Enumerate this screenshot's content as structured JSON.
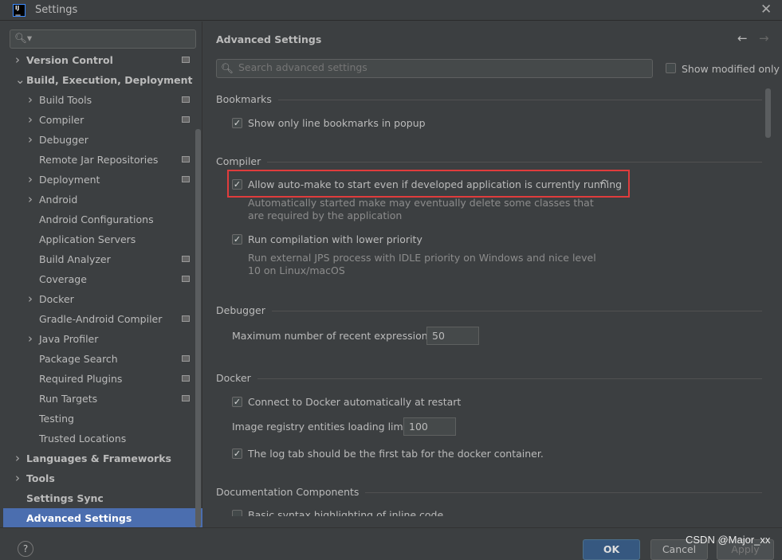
{
  "window": {
    "title": "Settings",
    "logo": "IJ"
  },
  "sidebar": {
    "search_placeholder": "",
    "items": [
      {
        "label": "Version Control",
        "bold": true,
        "expand": "collapsed",
        "level": 0,
        "project_icon": true
      },
      {
        "label": "Build, Execution, Deployment",
        "bold": true,
        "expand": "expanded",
        "level": 0,
        "project_icon": false
      },
      {
        "label": "Build Tools",
        "expand": "collapsed",
        "level": 1,
        "project_icon": true
      },
      {
        "label": "Compiler",
        "expand": "collapsed",
        "level": 1,
        "project_icon": true
      },
      {
        "label": "Debugger",
        "expand": "collapsed",
        "level": 1,
        "project_icon": false
      },
      {
        "label": "Remote Jar Repositories",
        "level": 1,
        "project_icon": true
      },
      {
        "label": "Deployment",
        "expand": "collapsed",
        "level": 1,
        "project_icon": true
      },
      {
        "label": "Android",
        "expand": "collapsed",
        "level": 1,
        "project_icon": false
      },
      {
        "label": "Android Configurations",
        "level": 1,
        "project_icon": false
      },
      {
        "label": "Application Servers",
        "level": 1,
        "project_icon": false
      },
      {
        "label": "Build Analyzer",
        "level": 1,
        "project_icon": true
      },
      {
        "label": "Coverage",
        "level": 1,
        "project_icon": true
      },
      {
        "label": "Docker",
        "expand": "collapsed",
        "level": 1,
        "project_icon": false
      },
      {
        "label": "Gradle-Android Compiler",
        "level": 1,
        "project_icon": true
      },
      {
        "label": "Java Profiler",
        "expand": "collapsed",
        "level": 1,
        "project_icon": false
      },
      {
        "label": "Package Search",
        "level": 1,
        "project_icon": true
      },
      {
        "label": "Required Plugins",
        "level": 1,
        "project_icon": true
      },
      {
        "label": "Run Targets",
        "level": 1,
        "project_icon": true
      },
      {
        "label": "Testing",
        "level": 1,
        "project_icon": false
      },
      {
        "label": "Trusted Locations",
        "level": 1,
        "project_icon": false
      },
      {
        "label": "Languages & Frameworks",
        "bold": true,
        "expand": "collapsed",
        "level": 0
      },
      {
        "label": "Tools",
        "bold": true,
        "expand": "collapsed",
        "level": 0
      },
      {
        "label": "Settings Sync",
        "bold": true,
        "level": 0
      },
      {
        "label": "Advanced Settings",
        "bold": true,
        "level": 0,
        "selected": true
      }
    ]
  },
  "main": {
    "title": "Advanced Settings",
    "search_placeholder": "Search advanced settings",
    "show_modified_label": "Show modified only",
    "show_modified_checked": false,
    "bookmarks": {
      "header": "Bookmarks",
      "opt1": "Show only line bookmarks in popup",
      "opt1_checked": true
    },
    "compiler": {
      "header": "Compiler",
      "opt1": "Allow auto-make to start even if developed application is currently running",
      "opt1_checked": true,
      "opt1_hint1": "Automatically started make may eventually delete some classes that",
      "opt1_hint2": "are required by the application",
      "opt2": "Run compilation with lower priority",
      "opt2_checked": true,
      "opt2_hint1": "Run external JPS process with IDLE priority on Windows and nice level",
      "opt2_hint2": "10 on Linux/macOS"
    },
    "debugger": {
      "header": "Debugger",
      "label": "Maximum number of recent expressions:",
      "value": "50"
    },
    "docker": {
      "header": "Docker",
      "opt1": "Connect to Docker automatically at restart",
      "opt1_checked": true,
      "limit_label": "Image registry entities loading limit:",
      "limit_value": "100",
      "opt2": "The log tab should be the first tab for the docker container.",
      "opt2_checked": true
    },
    "documentation": {
      "header": "Documentation Components",
      "opt1": "Basic syntax highlighting of inline code",
      "opt1_checked": false
    }
  },
  "footer": {
    "help": "?",
    "ok": "OK",
    "cancel": "Cancel",
    "apply": "Apply"
  },
  "watermark": "CSDN @Major_xx",
  "colors": {
    "selection": "#4b6eaf",
    "highlight_box": "#e03c3c",
    "ok_button": "#365880"
  }
}
